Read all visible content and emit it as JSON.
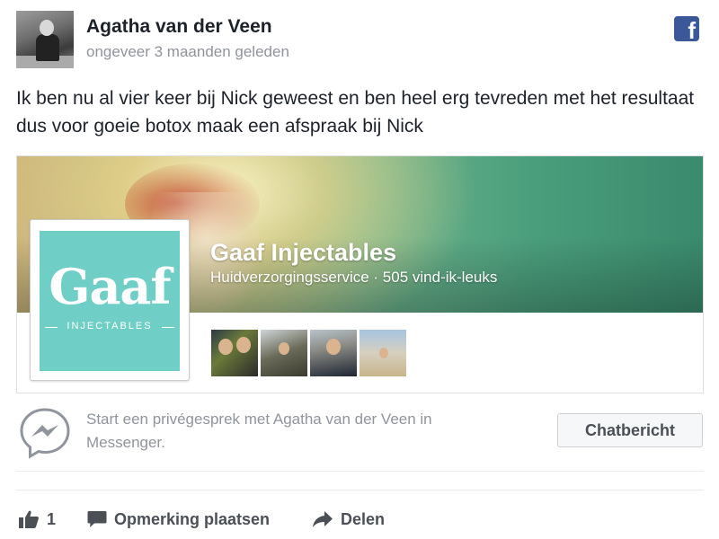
{
  "post": {
    "author": "Agatha van der Veen",
    "timestamp": "ongeveer 3 maanden geleden",
    "text": "Ik ben nu al vier keer bij Nick geweest en ben heel erg tevreden met het resultaat dus voor goeie botox maak een afspraak bij Nick"
  },
  "page_card": {
    "name": "Gaaf Injectables",
    "meta": "Huidverzorgingsservice · 505 vind-ik-leuks",
    "logo_word": "Gaaf",
    "logo_sub": "INJECTABLES"
  },
  "messenger": {
    "text": "Start een privégesprek met Agatha van der Veen in Messenger.",
    "button_label": "Chatbericht"
  },
  "actions": {
    "like_count": "1",
    "comment_label": "Opmerking plaatsen",
    "share_label": "Delen"
  },
  "colors": {
    "facebook_blue": "#3b5998",
    "logo_teal": "#6fcfc6",
    "secondary_text": "#90949c",
    "action_text": "#4b4f56"
  },
  "icons": [
    "facebook-logo-icon",
    "messenger-icon",
    "thumbs-up-icon",
    "comment-icon",
    "share-icon"
  ]
}
